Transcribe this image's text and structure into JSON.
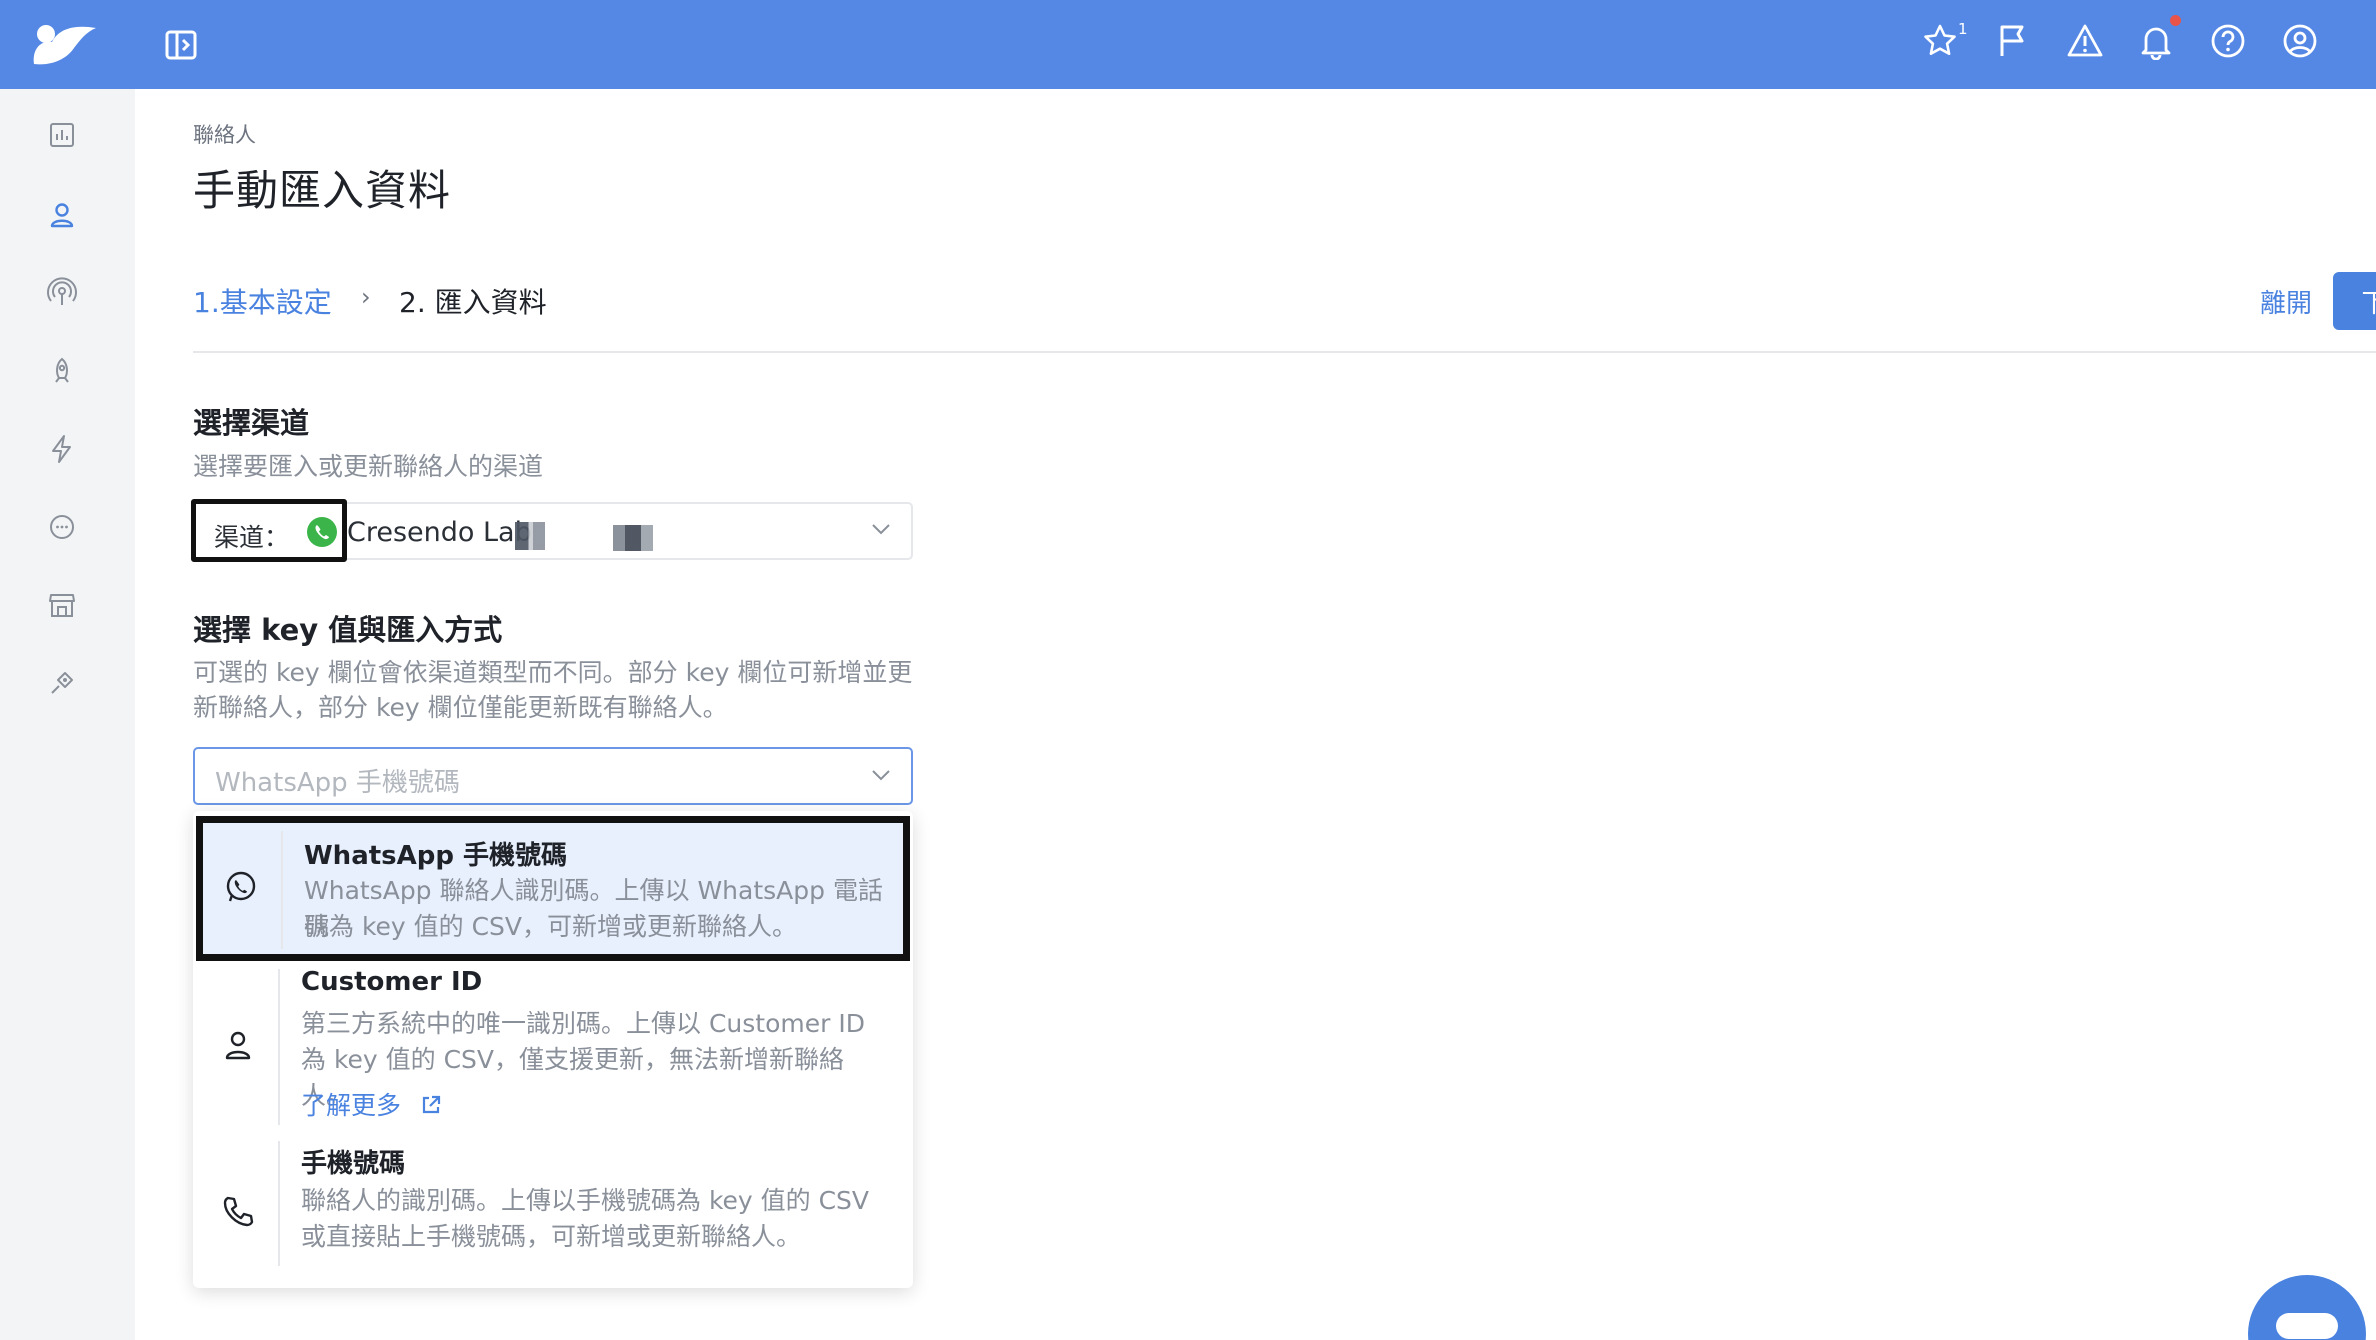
{
  "colors": {
    "topbar": "#5588e5",
    "accent": "#4a82e0",
    "whatsapp": "#3bb54a",
    "notification_dot": "#e8534a"
  },
  "topbar": {
    "favorites_badge": "1"
  },
  "breadcrumb": "聯絡人",
  "page_title": "手動匯入資料",
  "steps": {
    "step1": "1.基本設定",
    "separator": "›",
    "step2": "2. 匯入資料"
  },
  "actions": {
    "leave": "離開",
    "next": "下一步"
  },
  "channel_section": {
    "title": "選擇渠道",
    "description": "選擇要匯入或更新聯絡人的渠道",
    "label": "渠道：",
    "value": "Cresendo Lab"
  },
  "key_section": {
    "title": "選擇 key 值與匯入方式",
    "description_line1": "可選的 key 欄位會依渠道類型而不同。部分 key 欄位可新增並更",
    "description_line2": "新聯絡人，部分 key 欄位僅能更新既有聯絡人。",
    "placeholder": "WhatsApp 手機號碼"
  },
  "options": [
    {
      "title": "WhatsApp 手機號碼",
      "desc1": "WhatsApp 聯絡人識別碼。上傳以 WhatsApp 電話號",
      "desc2": "碼為 key 值的 CSV，可新增或更新聯絡人。",
      "icon": "whatsapp-icon"
    },
    {
      "title": "Customer ID",
      "desc1": "第三方系統中的唯一識別碼。上傳以 Customer ID",
      "desc2": "為 key 值的 CSV，僅支援更新，無法新增新聯絡人。",
      "link": "了解更多",
      "icon": "user-icon"
    },
    {
      "title": "手機號碼",
      "desc1": "聯絡人的識別碼。上傳以手機號碼為 key 值的 CSV",
      "desc2": "或直接貼上手機號碼，可新增或更新聯絡人。",
      "icon": "phone-icon"
    }
  ]
}
